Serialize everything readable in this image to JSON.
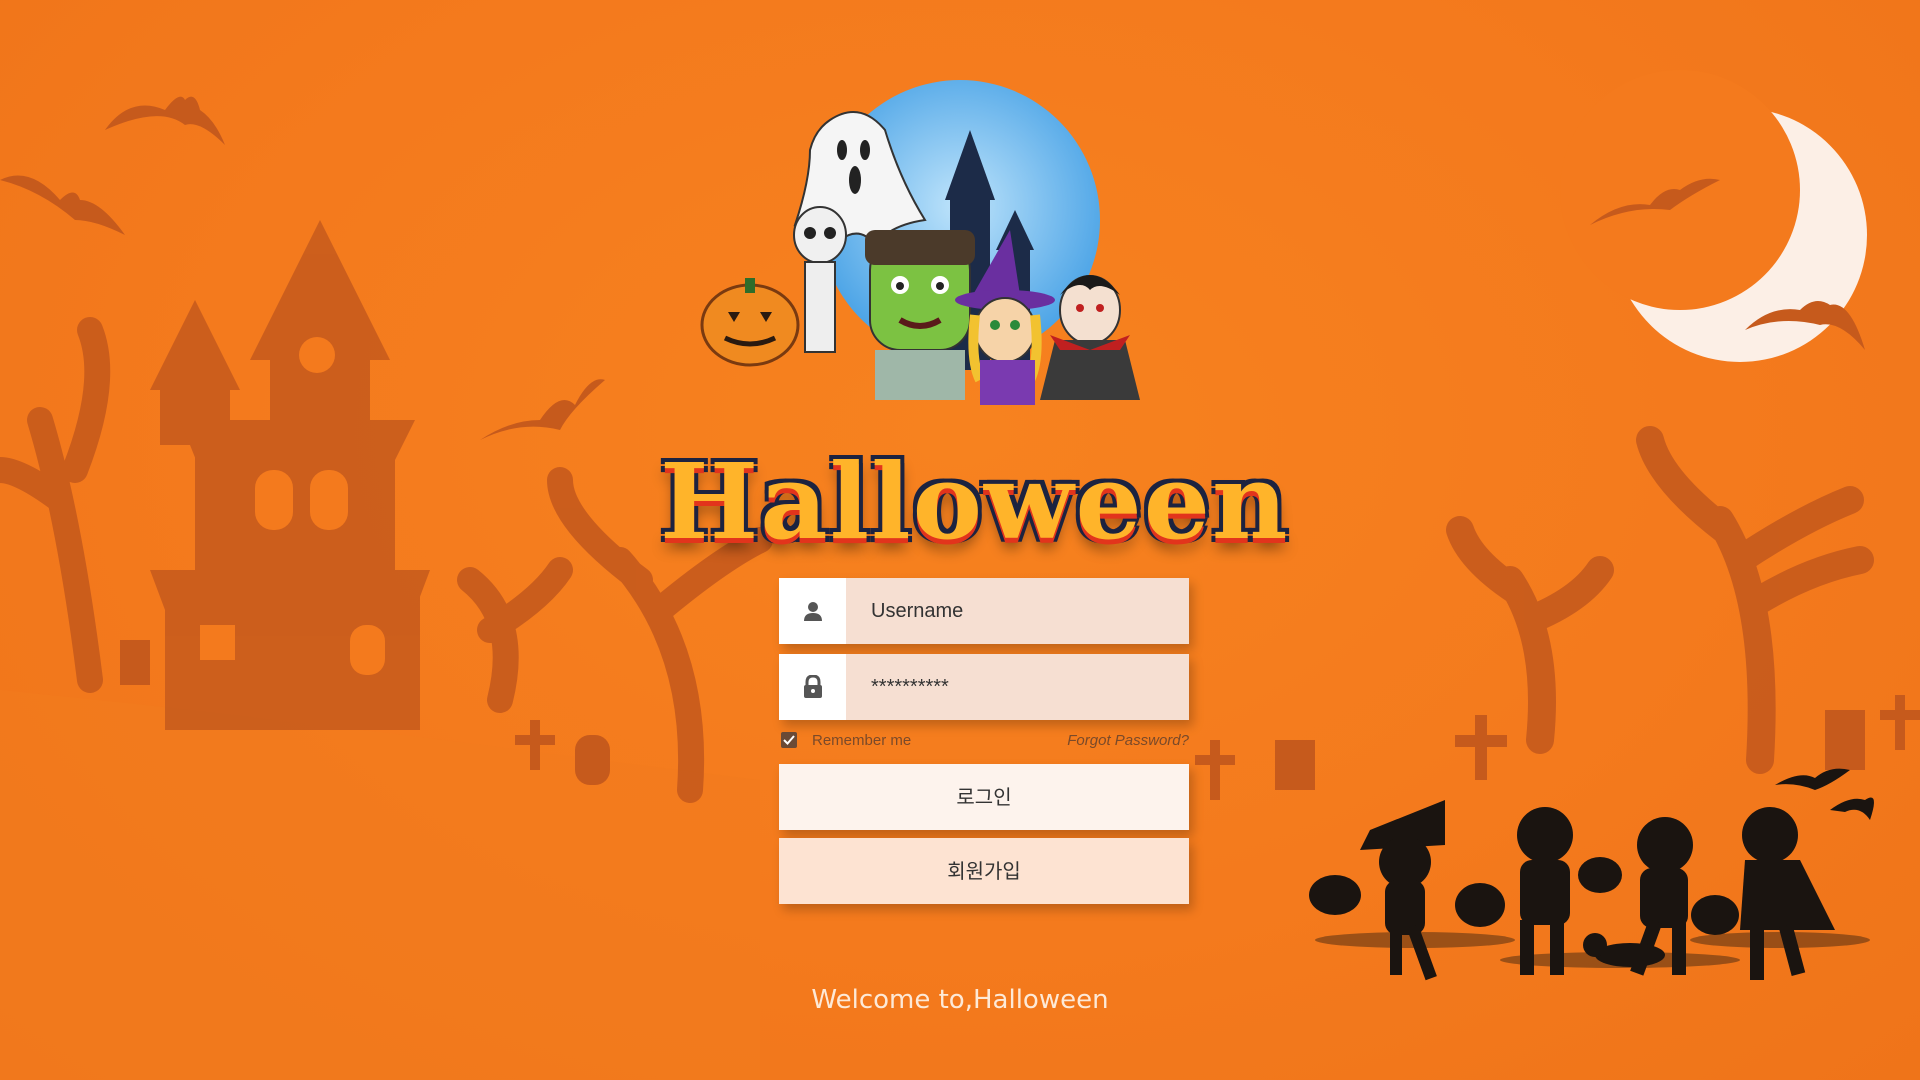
{
  "logo": {
    "title": "Halloween"
  },
  "login_form": {
    "username_value": "Username",
    "password_value": "**********",
    "remember_label": "Remember me",
    "remember_checked": true,
    "forgot_label": "Forgot Password?",
    "login_button": "로그인",
    "signup_button": "회원가입"
  },
  "footer": {
    "welcome_text": "Welcome to,Halloween"
  },
  "colors": {
    "background": "#f47a1d",
    "silhouette": "#c8561a",
    "field_bg": "#f6dfd2",
    "login_button_bg": "#fdf3ed",
    "signup_button_bg": "#fde3d2",
    "moon": "#fcefe6"
  }
}
